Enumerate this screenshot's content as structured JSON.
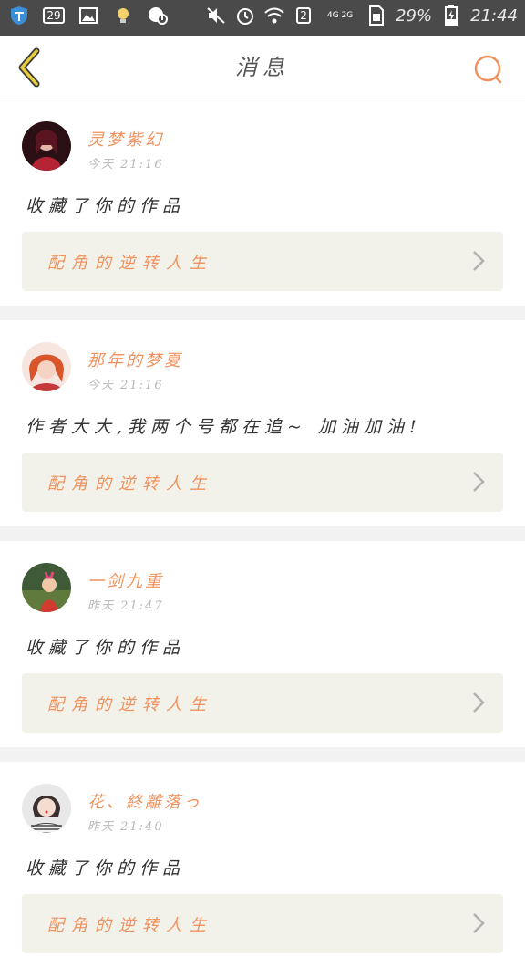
{
  "status_bar": {
    "sim_badge": "29",
    "sim_slot": "2",
    "network": "4G 2G",
    "battery": "29%",
    "time": "21:44"
  },
  "header": {
    "title": "消息"
  },
  "colors": {
    "accent": "#f0925e",
    "back_icon": "#e6cf3a",
    "work_box_bg": "#f2f1ea"
  },
  "messages": [
    {
      "username": "灵梦紫幻",
      "time": "今天 21:16",
      "text": "收藏了你的作品",
      "work": "配角的逆转人生"
    },
    {
      "username": "那年的梦夏",
      "time": "今天 21:16",
      "text": "作者大大,我两个号都在追~ 加油加油!",
      "work": "配角的逆转人生"
    },
    {
      "username": "一剑九重",
      "time": "昨天 21:47",
      "text": "收藏了你的作品",
      "work": "配角的逆转人生"
    },
    {
      "username": "花、終離落っ",
      "time": "昨天 21:40",
      "text": "收藏了你的作品",
      "work": "配角的逆转人生"
    }
  ]
}
